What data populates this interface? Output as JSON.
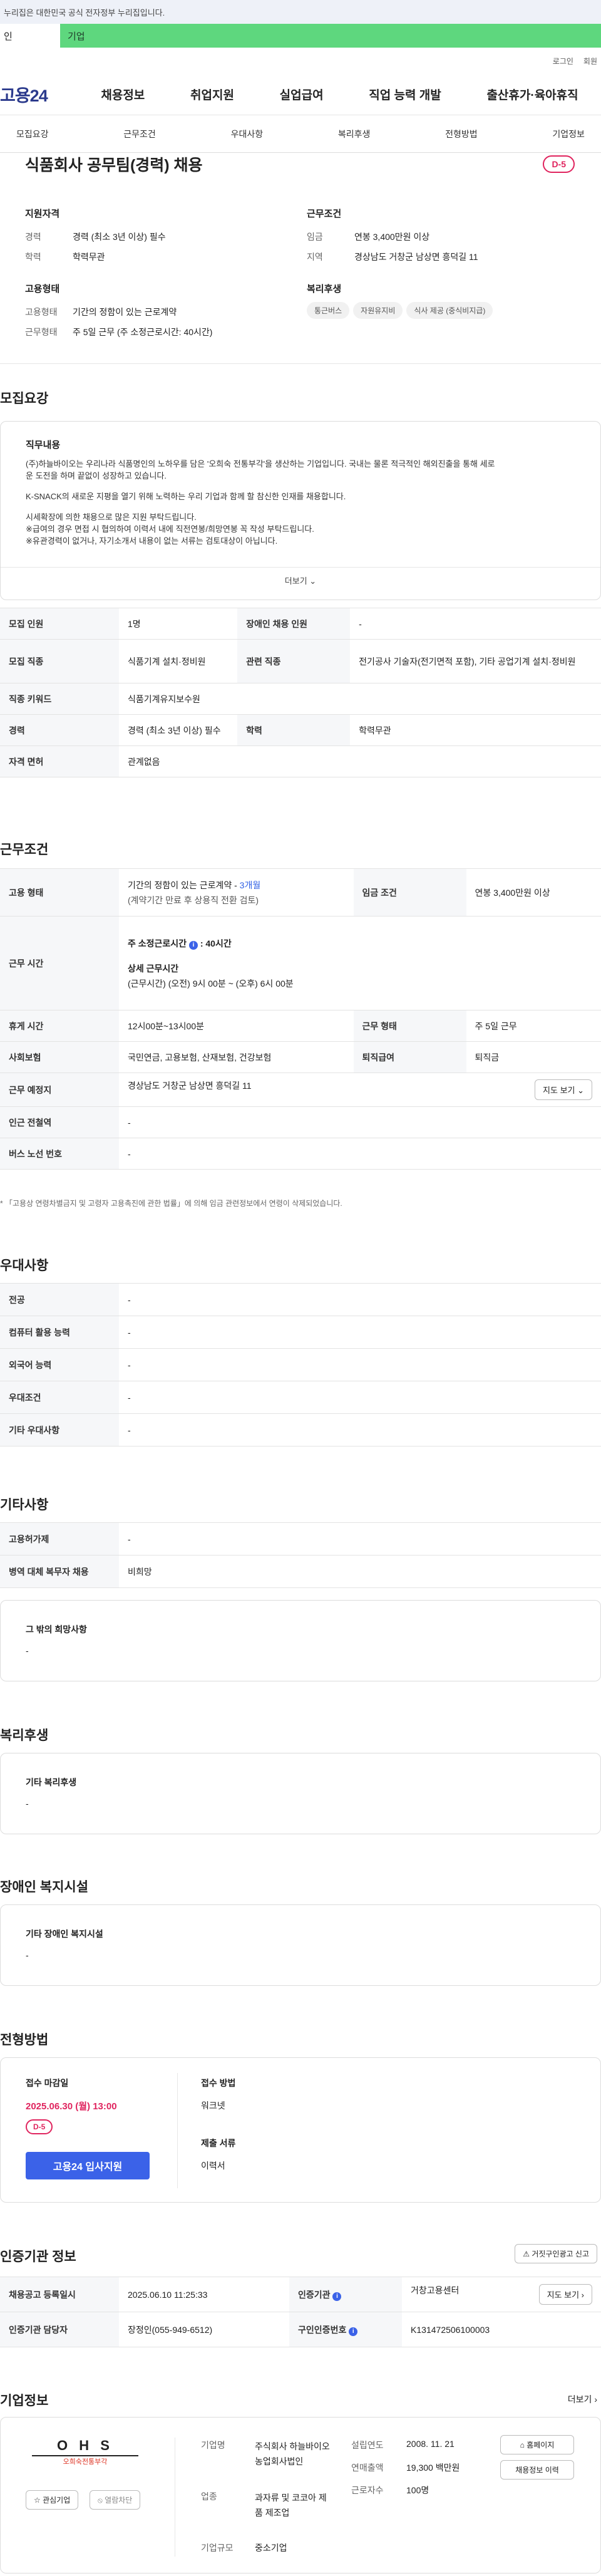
{
  "gov_banner": "누리집은 대한민국 공식 전자정부 누리집입니다.",
  "tabs": {
    "person": "인",
    "corp": "기업"
  },
  "util": {
    "login": "로그인",
    "join": "회원"
  },
  "logo": "고용24",
  "gnb": [
    "채용정보",
    "취업지원",
    "실업급여",
    "직업 능력 개발",
    "출산휴가·육아휴직"
  ],
  "anchors": [
    "모집요강",
    "근무조건",
    "우대사항",
    "복리후생",
    "전형방법",
    "기업정보"
  ],
  "summary": {
    "title": "식품회사 공무팀(경력) 채용",
    "dday": "D-5",
    "qual_heading": "지원자격",
    "qual": [
      {
        "k": "경력",
        "v": "경력 (최소 3년 이상) 필수"
      },
      {
        "k": "학력",
        "v": "학력무관"
      }
    ],
    "cond_heading": "근무조건",
    "cond": [
      {
        "k": "임금",
        "v": "연봉 3,400만원 이상"
      },
      {
        "k": "지역",
        "v": "경상남도 거창군 남상면 흥덕길 11"
      }
    ],
    "emp_heading": "고용형태",
    "emp": [
      {
        "k": "고용형태",
        "v": "기간의 정함이 있는 근로계약"
      },
      {
        "k": "근무형태",
        "v": "주 5일 근무 (주 소정근로시간: 40시간)"
      }
    ],
    "welfare_heading": "복리후생",
    "welfare_chips": [
      "통근버스",
      "자원유지비",
      "식사 제공 (중식비지급)"
    ]
  },
  "recruit": {
    "heading": "모집요강",
    "duty_heading": "직무내용",
    "duty_lines": [
      "(주)하늘바이오는 우리나라 식품명인의 노하우를 담은 '오희숙 전통부각'을 생산하는 기업입니다. 국내는 물론 적극적인 해외진출을 통해 세로",
      "운 도전을 하며 끝없이 성장하고 있습니다.",
      "K-SNACK의 새로운 지평을 열기 위해 노력하는 우리 기업과 함께 할 참신한 인재를 채용합니다.",
      "시세확장에 의한 채용으로 많은 지원 부탁드립니다.",
      "※급여의 경우 면접 시 협의하여 이력서 내에 직전연봉/희망연봉 꼭 작성 부탁드립니다.",
      "※유관경력이 없거나, 자기소개서 내용이 없는 서류는 검토대상이 아닙니다."
    ],
    "more": "더보기",
    "rows": [
      [
        {
          "th": "모집 인원",
          "td": "1명"
        },
        {
          "th": "장애인 채용 인원",
          "td": "-"
        }
      ],
      [
        {
          "th": "모집 직종",
          "td": "식품기계 설치·정비원"
        },
        {
          "th": "관련 직종",
          "td": "전기공사 기술자(전기면적 포함), 기타 공업기계 설치·정비원"
        }
      ],
      [
        {
          "th": "직종 키워드",
          "td": "식품기계유지보수원"
        }
      ],
      [
        {
          "th": "경력",
          "td": "경력 (최소 3년 이상) 필수"
        },
        {
          "th": "학력",
          "td": "학력무관"
        }
      ],
      [
        {
          "th": "자격 면허",
          "td": "관계없음"
        }
      ]
    ]
  },
  "work": {
    "heading": "근무조건",
    "employ_th": "고용 형태",
    "employ_line1": "기간의 정함이 있는 근로계약 - ",
    "employ_months": "3개월",
    "employ_line2": "(계약기간 만료 후 상용직 전환 검토)",
    "wage_th": "임금 조건",
    "wage": "연봉 3,400만원 이상",
    "hours_th": "근무 시간",
    "hours_week_label": "주 소정근로시간",
    "hours_week_value": ": 40시간",
    "hours_detail_label": "상세 근무시간",
    "hours_detail": "(근무시간) (오전) 9시 00분 ~ (오후) 6시 00분",
    "rows": [
      [
        {
          "th": "휴게 시간",
          "td": "12시00분~13시00분"
        },
        {
          "th": "근무 형태",
          "td": "주 5일 근무"
        }
      ],
      [
        {
          "th": "사회보험",
          "td": "국민연금, 고용보험, 산재보험, 건강보험"
        },
        {
          "th": "퇴직급여",
          "td": "퇴직금"
        }
      ]
    ],
    "place_th": "근무 예정지",
    "place": "경상남도 거창군 남상면 흥덕길 11",
    "map_btn": "지도 보기",
    "subway_th": "인근 전철역",
    "subway": "-",
    "bus_th": "버스 노선 번호",
    "bus": "-",
    "note": "* 「고용상 연령차별금지 및 고령자 고용촉진에 관한 법률」에 의해 임금 관련정보에서 연령이 삭제되었습니다."
  },
  "prefer": {
    "heading": "우대사항",
    "rows": [
      [
        "전공",
        "-"
      ],
      [
        "컴퓨터 활용 능력",
        "-"
      ],
      [
        "외국어 능력",
        "-"
      ],
      [
        "우대조건",
        "-"
      ],
      [
        "기타 우대사항",
        "-"
      ]
    ]
  },
  "etc": {
    "heading": "기타사항",
    "rows": [
      [
        "고용허가제",
        "-"
      ],
      [
        "병역 대체 복무자 채용",
        "비희망"
      ]
    ],
    "box_title": "그 밖의 희망사항",
    "box_value": "-"
  },
  "benefit": {
    "heading": "복리후생",
    "box_title": "기타 복리후생",
    "box_value": "-"
  },
  "disabled": {
    "heading": "장애인 복지시설",
    "box_title": "기타 장애인 복지시설",
    "box_value": "-"
  },
  "process": {
    "heading": "전형방법",
    "deadline_label": "접수 마감일",
    "deadline": "2025.06.30 (월) 13:00",
    "dday": "D-5",
    "apply_btn": "고용24 입사지원",
    "method_label": "접수 방법",
    "method": "워크넷",
    "docs_label": "제출 서류",
    "docs": "이력서"
  },
  "certified": {
    "heading": "인증기관 정보",
    "report_btn": "거짓구인광고 신고",
    "rows": [
      [
        {
          "th": "채용공고 등록일시",
          "td": "2025.06.10 11:25:33"
        },
        {
          "th": "인증기관",
          "td": "거창고용센터"
        }
      ],
      [
        {
          "th": "인증기관 담당자",
          "td": "장정인(055-949-6512)"
        },
        {
          "th": "구인인증번호",
          "td": "K131472506100003"
        }
      ]
    ],
    "map_btn": "지도 보기"
  },
  "company": {
    "heading": "기업정보",
    "more": "더보기",
    "logo_text": "오희숙전통부각",
    "logo_mark": "O H S",
    "fav_btn": "관심기업",
    "block_btn": "열람차단",
    "fields_left": [
      [
        "기업명",
        "주식회사 하늘바이오 농업회사법인"
      ],
      [
        "업종",
        "과자류 및 코코아 제품 제조업"
      ],
      [
        "기업규모",
        "중소기업"
      ]
    ],
    "fields_right": [
      [
        "설립연도",
        "2008. 11. 21"
      ],
      [
        "연매출액",
        "19,300 백만원"
      ],
      [
        "근로자수",
        "100명"
      ]
    ],
    "home_btn": "홈페이지",
    "hire_btn": "채용정보 이력"
  }
}
